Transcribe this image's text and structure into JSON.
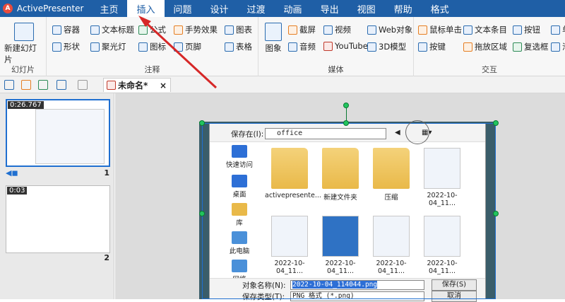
{
  "app": {
    "title": "ActivePresenter"
  },
  "menu": {
    "tabs": [
      "主页",
      "插入",
      "问题",
      "设计",
      "过渡",
      "动画",
      "导出",
      "视图",
      "帮助",
      "格式"
    ],
    "active_index": 1
  },
  "ribbon": {
    "slide_group": {
      "label": "幻灯片",
      "new_slide": "新建幻灯片"
    },
    "annot_group": {
      "label": "注释",
      "row1": [
        "容器",
        "文本标题",
        "公式",
        "手势效果",
        "图表"
      ],
      "row2": [
        "形状",
        "聚光灯",
        "图标",
        "页脚",
        "表格"
      ]
    },
    "media_group": {
      "label": "媒体",
      "image": "图象",
      "row1": [
        "截屏",
        "视频",
        "Web对象"
      ],
      "row2": [
        "音频",
        "YouTube",
        "3D模型"
      ]
    },
    "interact_group": {
      "label": "交互",
      "row1": [
        "鼠标单击",
        "文本条目",
        "按钮",
        "单"
      ],
      "row2": [
        "按键",
        "拖放区域",
        "复选框",
        "滑"
      ]
    }
  },
  "toolbar": {
    "doc_title": "未命名*",
    "close": "×"
  },
  "slides": [
    {
      "time": "0:26.767",
      "number": "1"
    },
    {
      "time": "0:03",
      "number": "2"
    }
  ],
  "dialog": {
    "save_in_label": "保存在(I):",
    "save_in_value": "office",
    "sidebar": [
      "快速访问",
      "桌面",
      "库",
      "此电脑",
      "网络"
    ],
    "files": [
      {
        "name": "activepresente...",
        "kind": "folder"
      },
      {
        "name": "新建文件夹",
        "kind": "folder"
      },
      {
        "name": "压缩",
        "kind": "folder"
      },
      {
        "name": "2022-10-04_11...",
        "kind": "shot"
      },
      {
        "name": "2022-10-04_11...",
        "kind": "shot"
      },
      {
        "name": "2022-10-04_11...",
        "kind": "shot-blue"
      },
      {
        "name": "2022-10-04_11...",
        "kind": "shot"
      },
      {
        "name": "2022-10-04_11...",
        "kind": "shot"
      }
    ],
    "filename_label": "对象名称(N):",
    "filename_value": "2022-10-04_114044.png",
    "filetype_label": "保存类型(T):",
    "filetype_value": "PNG 格式 (*.png)",
    "save_button": "保存(S)",
    "cancel_button": "取消"
  },
  "colors": {
    "titlebar": "#1f5fa6",
    "accent": "#1f6fd0",
    "handle": "#22c55e",
    "arrow": "#d62828"
  }
}
